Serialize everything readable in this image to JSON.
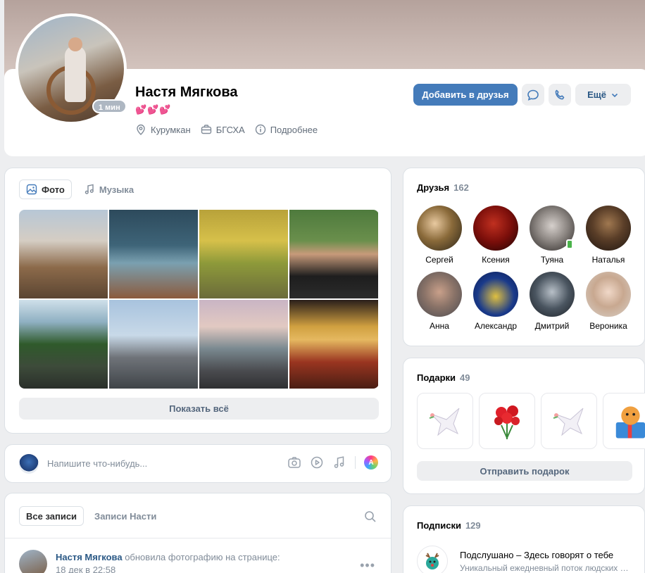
{
  "profile": {
    "name": "Настя Мягкова",
    "status": "💕💕💕",
    "online": "1 мин",
    "location": "Курумкан",
    "education": "БГСХА",
    "more_info": "Подробнее"
  },
  "actions": {
    "add_friend": "Добавить в друзья",
    "more": "Ещё"
  },
  "photos": {
    "tab_photo": "Фото",
    "tab_music": "Музыка",
    "show_all": "Показать всё"
  },
  "composer": {
    "placeholder": "Напишите что-нибудь..."
  },
  "wall": {
    "tab_all": "Все записи",
    "tab_owner": "Записи Насти",
    "post": {
      "author": "Настя Мягкова",
      "action": "обновила фотографию на странице:",
      "date": "18 дек в 22:58"
    }
  },
  "friends": {
    "title": "Друзья",
    "count": "162",
    "items": [
      {
        "name": "Сергей"
      },
      {
        "name": "Ксения"
      },
      {
        "name": "Туяна"
      },
      {
        "name": "Наталья"
      },
      {
        "name": "Анна"
      },
      {
        "name": "Александр"
      },
      {
        "name": "Дмитрий"
      },
      {
        "name": "Вероника"
      }
    ]
  },
  "gifts": {
    "title": "Подарки",
    "count": "49",
    "send": "Отправить подарок"
  },
  "subscriptions": {
    "title": "Подписки",
    "count": "129",
    "item": {
      "title": "Подслушано – Здесь говорят о тебе",
      "desc": "Уникальный ежедневный поток людских …"
    }
  },
  "colors": {
    "accent": "#447bba",
    "link": "#2a5885",
    "muted": "#818c99",
    "background": "#edeef0"
  }
}
